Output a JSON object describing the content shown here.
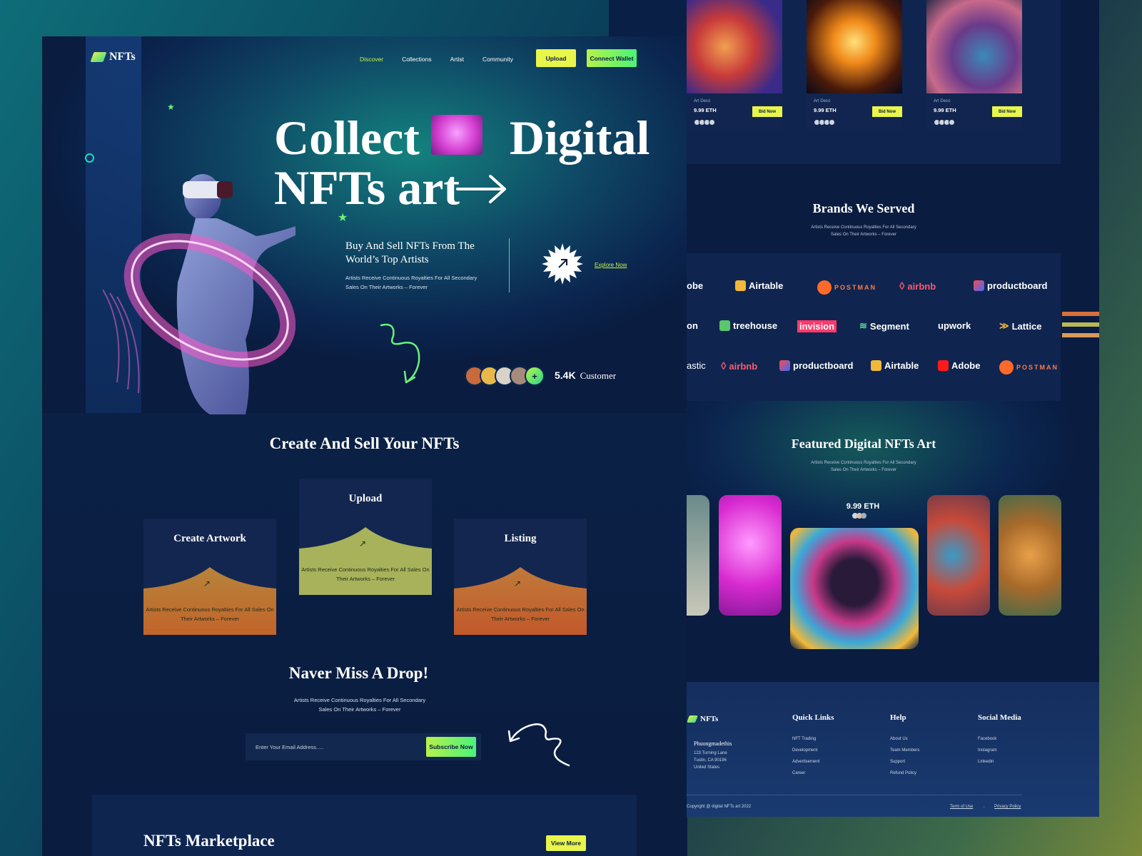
{
  "header": {
    "logo": "NFTs",
    "nav": [
      "Discover",
      "Collections",
      "Artist",
      "Community"
    ],
    "upload": "Upload",
    "connect": "Connect Wallet"
  },
  "hero": {
    "line1a": "Collect",
    "line1b": "Digital",
    "line2": "NFTs art",
    "subtitle": "Buy And Sell NFTs From The World’s Top Artists",
    "desc": "Artists Receive Continuous Royalties For All Secondary Sales On Their Artworks – Forever",
    "explore": "Explore Now",
    "customer_count": "5.4K",
    "customer_label": "Customer",
    "plus": "+"
  },
  "create": {
    "title": "Create And Sell Your NFTs",
    "cards": [
      {
        "title": "Create Artwork",
        "text": "Artists Receive Continuous Royalties For All Sales On Their Artworks – Forever"
      },
      {
        "title": "Upload",
        "text": "Artists Receive Continuous Royalties For All Sales On Their Artworks – Forever"
      },
      {
        "title": "Listing",
        "text": "Artists Receive Continuous Royalties For All Sales On Their Artworks – Forever"
      }
    ]
  },
  "drop": {
    "title": "Naver Miss A Drop!",
    "desc": "Artists Receive Continuous Royalties For All Secondary Sales On Their Artworks – Forever",
    "placeholder": "Enter Your Email Address.....",
    "button": "Subscribe Now"
  },
  "market": {
    "title": "NFTs Marketplace",
    "button": "View More"
  },
  "top_cards": [
    {
      "tag": "Art Deco",
      "price": "9.99 ETH",
      "bid": "Bid Now"
    },
    {
      "tag": "Art Deco",
      "price": "9.99 ETH",
      "bid": "Bid Now"
    },
    {
      "tag": "Art Deco",
      "price": "9.99 ETH",
      "bid": "Bid Now"
    }
  ],
  "brands": {
    "title": "Brands We Served",
    "desc": "Artists Receive Continuous Royalties For All Secondary Sales On Their Artworks – Forever",
    "row1": [
      "obe",
      "Airtable",
      "POSTMAN",
      "airbnb",
      "productboard"
    ],
    "row2": [
      "on",
      "treehouse",
      "invision",
      "Segment",
      "upwork",
      "Lattice"
    ],
    "row3": [
      "astic",
      "airbnb",
      "productboard",
      "Airtable",
      "Adobe",
      "POSTMAN"
    ]
  },
  "featured": {
    "title": "Featured Digital NFTs Art",
    "desc": "Artists Receive Continuous Royalties For All Secondary Sales On Their Artworks – Forever",
    "price": "9.99 ETH"
  },
  "footer": {
    "logo": "NFTs",
    "name": "Phuongmadethis",
    "addr1": "123 Turning Lane",
    "addr2": "Tustin, CA 90196",
    "addr3": "United States",
    "quick_title": "Quick Links",
    "quick": [
      "NFT Trading",
      "Development",
      "Advertisement",
      "Career"
    ],
    "help_title": "Help",
    "help": [
      "About Us",
      "Team Members",
      "Support",
      "Refund Policy"
    ],
    "social_title": "Social Media",
    "social": [
      "Facebook",
      "Instagram",
      "Linkedin"
    ],
    "copyright": "Copyright @ digital NFTs art 2022",
    "terms": "Term of Use",
    "sep": ".",
    "privacy": "Privacy Policy"
  }
}
